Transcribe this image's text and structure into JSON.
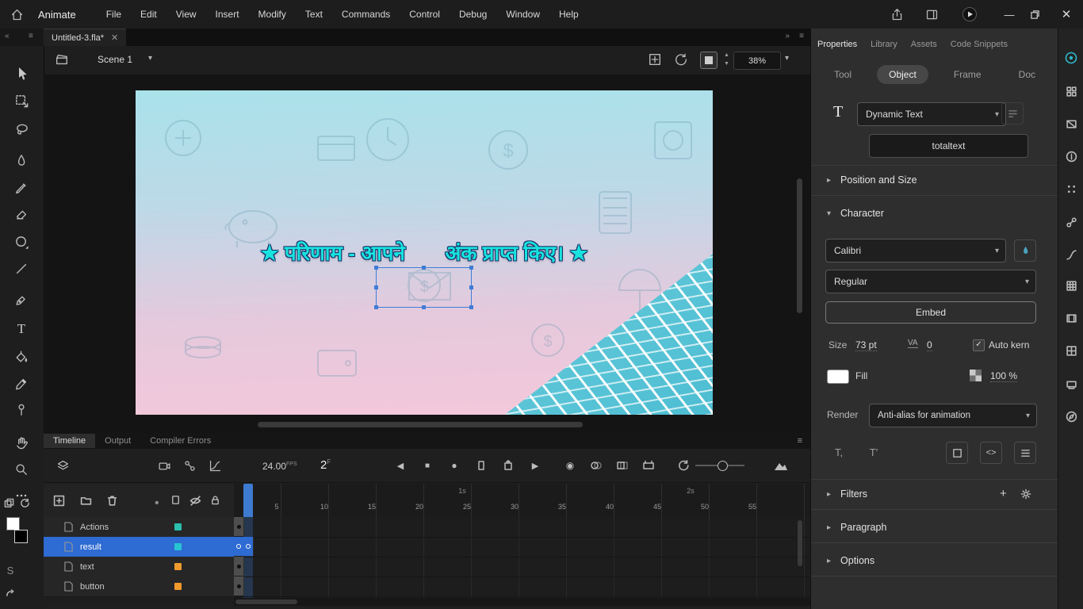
{
  "app": {
    "title": "Animate"
  },
  "menubar": {
    "items": [
      "File",
      "Edit",
      "View",
      "Insert",
      "Modify",
      "Text",
      "Commands",
      "Control",
      "Debug",
      "Window",
      "Help"
    ]
  },
  "doc_tab": {
    "title": "Untitled-3.fla*"
  },
  "scene_bar": {
    "scene": "Scene 1",
    "zoom": "38%"
  },
  "stage": {
    "headline": "★ परिणाम - आपने       अंक प्राप्त किए। ★"
  },
  "properties": {
    "tabs": [
      "Properties",
      "Library",
      "Assets",
      "Code Snippets"
    ],
    "active_tab": "Properties",
    "subtabs": [
      "Tool",
      "Object",
      "Frame",
      "Doc"
    ],
    "active_subtab": "Object",
    "text_type": "Dynamic Text",
    "instance_name": "totaltext",
    "position_section": "Position and Size",
    "character_section": "Character",
    "font": "Calibri",
    "font_style": "Regular",
    "embed_button": "Embed",
    "size_label": "Size",
    "size_value": "73 pt",
    "tracking_value": "0",
    "auto_kern_label": "Auto kern",
    "auto_kern_checked": true,
    "fill_label": "Fill",
    "fill_color": "#FFFFFF",
    "alpha_value": "100 %",
    "render_label": "Render",
    "render_value": "Anti-alias for animation",
    "filters_section": "Filters",
    "paragraph_section": "Paragraph",
    "options_section": "Options"
  },
  "timeline": {
    "tabs": [
      "Timeline",
      "Output",
      "Compiler Errors"
    ],
    "active_tab": "Timeline",
    "fps": "24.00",
    "fps_unit": "FPS",
    "current_frame": "2",
    "frame_unit": "F",
    "ruler_numbers": [
      5,
      10,
      15,
      20,
      25,
      30,
      35,
      40,
      45,
      50,
      55
    ],
    "second_markers": [
      {
        "label": "1s",
        "frame": 24
      },
      {
        "label": "2s",
        "frame": 48
      }
    ],
    "playhead_frame": 2,
    "layers": [
      {
        "name": "Actions",
        "color": "#2BBFae",
        "selected": false,
        "keyframes": [
          1
        ]
      },
      {
        "name": "result",
        "color": "#27C4D4",
        "selected": true,
        "keyframes": [
          1,
          2
        ]
      },
      {
        "name": "text",
        "color": "#F09A2E",
        "selected": false,
        "keyframes": [
          1
        ]
      },
      {
        "name": "button",
        "color": "#F09A2E",
        "selected": false,
        "keyframes": [
          1
        ]
      }
    ]
  },
  "left_toolbar": {
    "tools": [
      "selection",
      "free-transform",
      "lasso",
      "fluid-brush",
      "classic-brush",
      "eraser",
      "oval",
      "line",
      "pen",
      "text",
      "paint-bucket",
      "eyedropper",
      "asset-warp",
      "hand",
      "zoom",
      "more"
    ]
  },
  "colors": {
    "accent": "#3D7BD0",
    "selection_blue": "#2E6BD2",
    "stage_text": "#19E3DE"
  }
}
